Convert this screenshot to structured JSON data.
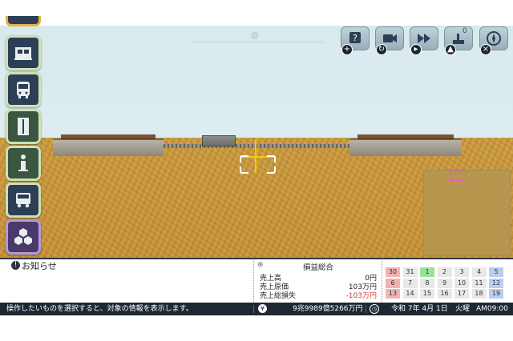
{
  "toolbar": {
    "counter": "0"
  },
  "notice": {
    "label": "お知らせ"
  },
  "profit_loss": {
    "title": "損益総合",
    "rows": [
      {
        "label": "売上高",
        "value": "0円",
        "negative": false
      },
      {
        "label": "売上原価",
        "value": "103万円",
        "negative": false
      },
      {
        "label": "売上総損失",
        "value": "-103万円",
        "negative": true
      }
    ]
  },
  "calendar": {
    "days": [
      {
        "n": "30",
        "color": "#f3b3b3"
      },
      {
        "n": "31",
        "color": "#e8e8e8"
      },
      {
        "n": "1",
        "color": "#9be39b"
      },
      {
        "n": "2",
        "color": "#e8e8e8"
      },
      {
        "n": "3",
        "color": "#e8e8e8"
      },
      {
        "n": "4",
        "color": "#e8e8e8"
      },
      {
        "n": "5",
        "color": "#b9cdee"
      },
      {
        "n": "6",
        "color": "#f3b3b3"
      },
      {
        "n": "7",
        "color": "#e8e8e8"
      },
      {
        "n": "8",
        "color": "#e8e8e8"
      },
      {
        "n": "9",
        "color": "#e8e8e8"
      },
      {
        "n": "10",
        "color": "#e8e8e8"
      },
      {
        "n": "11",
        "color": "#e8e8e8"
      },
      {
        "n": "12",
        "color": "#b9cdee"
      },
      {
        "n": "13",
        "color": "#f3b3b3"
      },
      {
        "n": "14",
        "color": "#e8e8e8"
      },
      {
        "n": "15",
        "color": "#e8e8e8"
      },
      {
        "n": "16",
        "color": "#e8e8e8"
      },
      {
        "n": "17",
        "color": "#e8e8e8"
      },
      {
        "n": "18",
        "color": "#e8e8e8"
      },
      {
        "n": "19",
        "color": "#b9cdee"
      }
    ]
  },
  "status": {
    "hint": "操作したいものを選択すると、対象の情報を表示します。",
    "money": "9兆9989億5266万円",
    "date": "令和 7年 4月 1日",
    "weekday": "火曜",
    "time": "AM09:00"
  },
  "colors": {
    "cursor": "#f1d000",
    "status_bar": "#1e2833",
    "side_button": "#2d3f55"
  }
}
